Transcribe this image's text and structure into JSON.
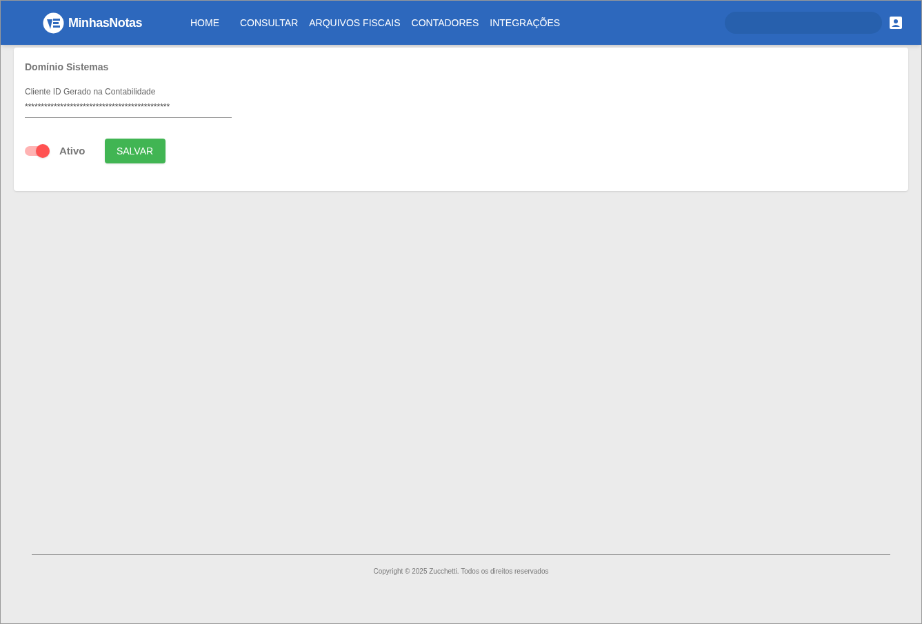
{
  "header": {
    "logo": "MinhasNotas",
    "nav": [
      {
        "label": "HOME"
      },
      {
        "label": "CONSULTAR"
      },
      {
        "label": "ARQUIVOS FISCAIS"
      },
      {
        "label": "CONTADORES"
      },
      {
        "label": "INTEGRAÇÕES"
      }
    ]
  },
  "card": {
    "title": "Domínio Sistemas",
    "field": {
      "label": "Cliente ID Gerado na Contabilidade",
      "value": "*********************************************"
    },
    "toggle": {
      "label": "Ativo",
      "on": true
    },
    "save_button": "SALVAR"
  },
  "footer": {
    "copyright": "Copyright © 2025 Zucchetti. Todos os direitos reservados"
  }
}
